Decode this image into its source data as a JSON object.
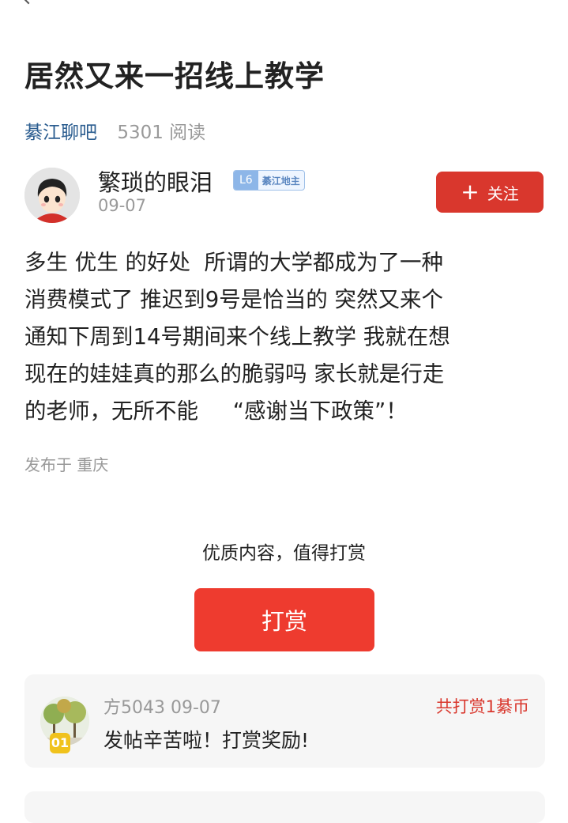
{
  "post": {
    "title": "居然又来一招线上教学",
    "forum_name": "綦江聊吧",
    "read_count": "5301 阅读",
    "content_lines": [
      "多生 优生 的好处  所谓的大学都成为了一种",
      "消费模式了 推迟到9号是恰当的 突然又来个",
      "通知下周到14号期间来个线上教学 我就在想",
      "现在的娃娃真的那么的脆弱吗 家长就是行走",
      "的老师，无所不能     “感谢当下政策”！"
    ],
    "location": "发布于 重庆"
  },
  "author": {
    "name": "繁琐的眼泪",
    "level": "L6",
    "title_badge": "綦江地主",
    "date": "09-07",
    "avatar_icon": "cartoon-avatar"
  },
  "follow_button": {
    "label": "关注",
    "icon": "plus-icon"
  },
  "tip": {
    "prompt": "优质内容，值得打赏",
    "button_label": "打赏"
  },
  "tip_records": [
    {
      "rank": "01",
      "user_and_date": "方5043 09-07",
      "total": "共打赏1綦币",
      "message": "发帖辛苦啦！打赏奖励!"
    }
  ],
  "colors": {
    "accent_red": "#d9372d",
    "button_red": "#ee3b2f",
    "forum_blue": "#2a5c8f",
    "muted_gray": "#999999"
  }
}
